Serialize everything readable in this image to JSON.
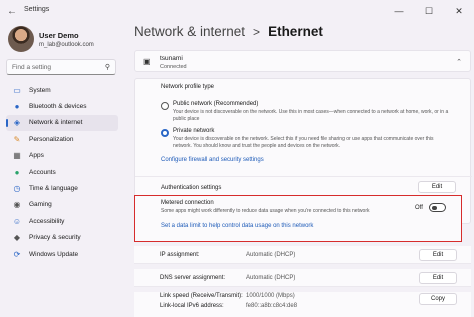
{
  "window": {
    "title": "Settings",
    "minimize_icon": "minimize-icon",
    "maximize_icon": "maximize-icon",
    "close_icon": "close-icon"
  },
  "user": {
    "name": "User Demo",
    "email": "m_lab@outlook.com"
  },
  "search": {
    "placeholder": "Find a setting"
  },
  "sidebar": {
    "items": [
      {
        "label": "System",
        "icon": "monitor-icon",
        "color": "#2a66c6"
      },
      {
        "label": "Bluetooth & devices",
        "icon": "bluetooth-icon",
        "color": "#2a66c6"
      },
      {
        "label": "Network & internet",
        "icon": "wifi-icon",
        "color": "#2a66c6",
        "active": true
      },
      {
        "label": "Personalization",
        "icon": "brush-icon",
        "color": "#d88a2a"
      },
      {
        "label": "Apps",
        "icon": "apps-icon",
        "color": "#555555"
      },
      {
        "label": "Accounts",
        "icon": "person-icon",
        "color": "#2aa36b"
      },
      {
        "label": "Time & language",
        "icon": "globe-clock-icon",
        "color": "#2a66c6"
      },
      {
        "label": "Gaming",
        "icon": "gamepad-icon",
        "color": "#555555"
      },
      {
        "label": "Accessibility",
        "icon": "accessibility-icon",
        "color": "#2a66c6"
      },
      {
        "label": "Privacy & security",
        "icon": "shield-icon",
        "color": "#555555"
      },
      {
        "label": "Windows Update",
        "icon": "update-icon",
        "color": "#2a66c6"
      }
    ]
  },
  "breadcrumb": {
    "parent": "Network & internet",
    "separator": ">",
    "current": "Ethernet"
  },
  "network": {
    "name": "tsunami",
    "status": "Connected"
  },
  "profile": {
    "heading": "Network profile type",
    "public_title": "Public network (Recommended)",
    "public_desc": "Your device is not discoverable on the network. Use this in most cases—when connected to a network at home, work, or in a public place",
    "private_title": "Private network",
    "private_desc": "Your device is discoverable on the network. Select this if you need file sharing or use apps that communicate over this network. You should know and trust the people and devices on the network.",
    "selected": "private",
    "firewall_link": "Configure firewall and security settings"
  },
  "auth": {
    "label": "Authentication settings",
    "button": "Edit"
  },
  "metered": {
    "title": "Metered connection",
    "desc": "Some apps might work differently to reduce data usage when you're connected to this network",
    "state": "Off",
    "link": "Set a data limit to help control data usage on this network"
  },
  "details": {
    "ip_label": "IP assignment:",
    "ip_value": "Automatic (DHCP)",
    "ip_button": "Edit",
    "dns_label": "DNS server assignment:",
    "dns_value": "Automatic (DHCP)",
    "dns_button": "Edit",
    "speed_label": "Link speed (Receive/Transmit):",
    "speed_value": "1000/1000 (Mbps)",
    "speed_button": "Copy",
    "ipv6_label": "Link-local IPv6 address:",
    "ipv6_value": "fe80::a8b:c8c4:de8"
  }
}
